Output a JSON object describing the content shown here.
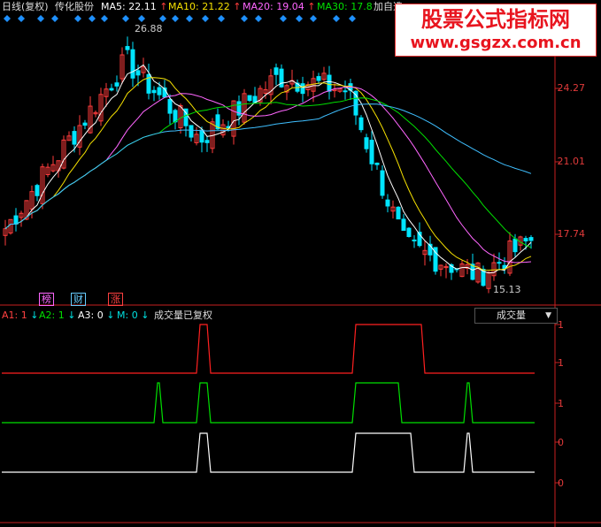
{
  "header": {
    "period_label": "日线(复权)",
    "stock_name": "传化股份",
    "ma5": {
      "label": "MA5:",
      "value": "22.11",
      "arrow": "↑",
      "color": "#ffffff"
    },
    "ma10": {
      "label": "MA10:",
      "value": "21.22",
      "arrow": "↑",
      "color": "#f5e000"
    },
    "ma20": {
      "label": "MA20:",
      "value": "19.04",
      "arrow": "↑",
      "color": "#ff66ff"
    },
    "ma30": {
      "label": "MA30:",
      "value": "17.8",
      "arrow": "",
      "color": "#00e000"
    },
    "extra": "加自选"
  },
  "watermark": {
    "title": "股票公式指标网",
    "url": "www.gsgzx.com.cn"
  },
  "price_axis": {
    "labels": [
      "24.27",
      "21.01",
      "17.74"
    ]
  },
  "annotations": {
    "high": "26.88",
    "low": "15.13"
  },
  "badges": [
    {
      "text": "榜",
      "color": "#ff66ff"
    },
    {
      "text": "财",
      "color": "#66ccff"
    },
    {
      "text": "涨",
      "color": "#ff4040"
    }
  ],
  "indicator": {
    "a1": {
      "label": "A1: 1",
      "arrow": "↓",
      "color": "#ff4040"
    },
    "a2": {
      "label": "A2: 1",
      "arrow": "↓",
      "color": "#00e000"
    },
    "a3": {
      "label": "A3: 0",
      "arrow": "↓",
      "color": "#ffffff"
    },
    "m": {
      "label": "M: 0",
      "arrow": "↓",
      "color": "#00e0e0"
    },
    "note": "成交量已复权",
    "selector": "成交量",
    "axis_labels": [
      "1",
      "1",
      "1",
      "0",
      "0"
    ]
  },
  "colors": {
    "up": "#ff3c3c",
    "down": "#00e5ff",
    "axis": "#c82020"
  }
}
